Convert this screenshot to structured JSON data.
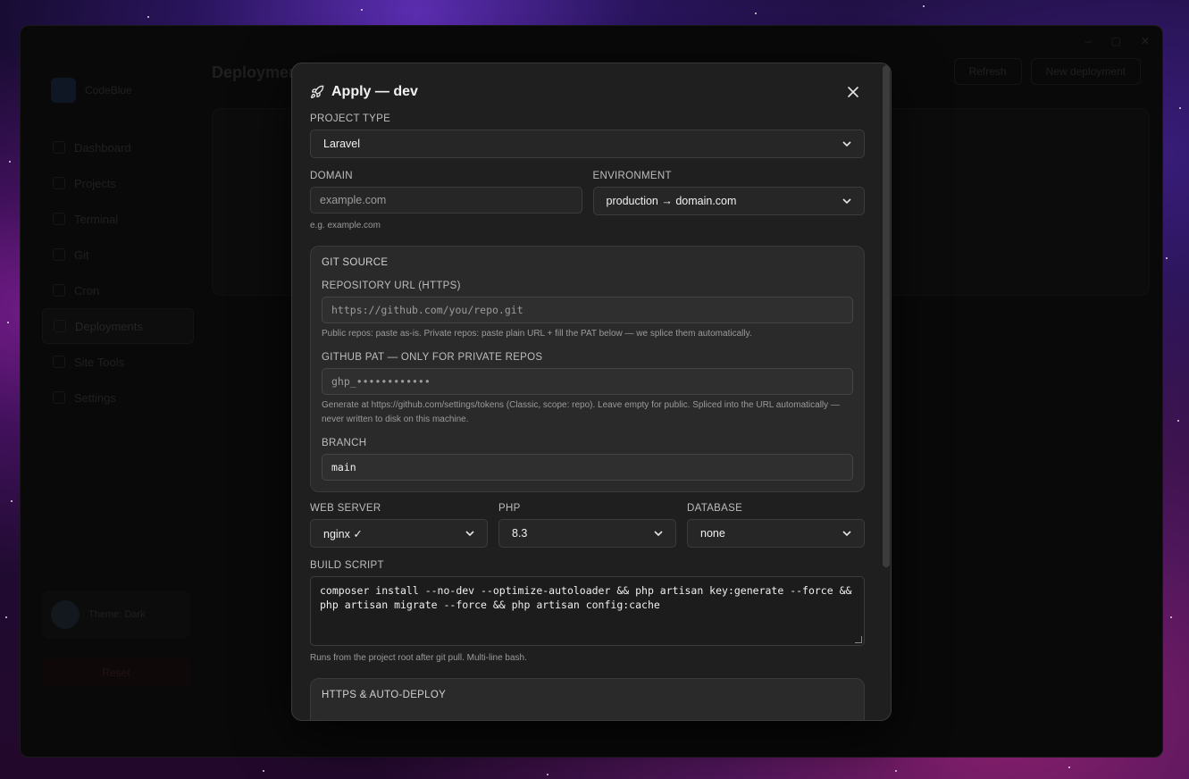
{
  "background_app": {
    "page_title": "Deployments",
    "topbar_buttons": [
      "Refresh",
      "New deployment"
    ],
    "brand": "CodeBlue",
    "nav": [
      "Dashboard",
      "Projects",
      "Terminal",
      "Git",
      "Cron",
      "Deployments",
      "Site Tools",
      "Settings"
    ],
    "user": "Theme: Dark",
    "danger_button": "Reset"
  },
  "modal": {
    "title": "Apply — dev",
    "rocket_icon": "rocket-icon",
    "close_icon": "×",
    "project_type": {
      "label": "PROJECT TYPE",
      "value": "Laravel"
    },
    "domain": {
      "label": "DOMAIN",
      "placeholder": "example.com",
      "hint": "e.g. example.com"
    },
    "environment": {
      "label": "ENVIRONMENT",
      "value": "production → domain.com"
    },
    "git_source": {
      "title": "GIT SOURCE",
      "repo_url": {
        "label": "REPOSITORY URL (HTTPS)",
        "placeholder": "https://github.com/you/repo.git",
        "hint": "Public repos: paste as-is. Private repos: paste plain URL + fill the PAT below — we splice them automatically."
      },
      "github_pat": {
        "label": "GITHUB PAT — ONLY FOR PRIVATE REPOS",
        "placeholder": "ghp_••••••••••••",
        "hint": "Generate at https://github.com/settings/tokens (Classic, scope: repo). Leave empty for public. Spliced into the URL automatically — never written to disk on this machine."
      },
      "branch": {
        "label": "BRANCH",
        "value": "main"
      }
    },
    "web_server": {
      "label": "WEB SERVER",
      "value": "nginx ✓"
    },
    "php": {
      "label": "PHP",
      "value": "8.3"
    },
    "database": {
      "label": "DATABASE",
      "value": "none"
    },
    "build_script": {
      "label": "BUILD SCRIPT",
      "value": "composer install --no-dev --optimize-autoloader && php artisan key:generate --force && php artisan migrate --force && php artisan config:cache",
      "hint": "Runs from the project root after git pull. Multi-line bash."
    },
    "https_panel": {
      "title": "HTTPS & AUTO-DEPLOY"
    }
  }
}
